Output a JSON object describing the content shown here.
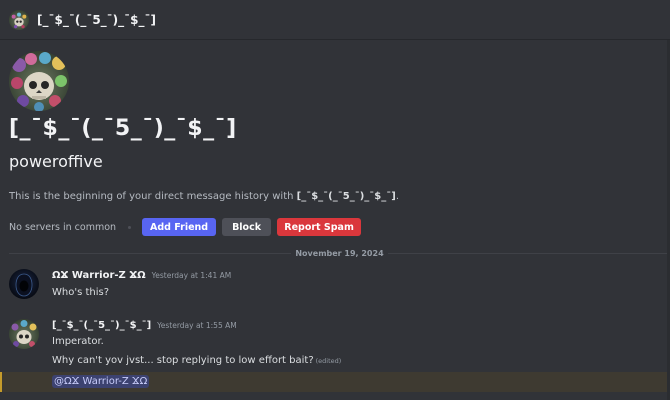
{
  "header": {
    "title": "[_ˉ$_ˉ(_ˉ5_ˉ)_ˉ$_ˉ]",
    "avatar_icon": "decorated-skull-avatar"
  },
  "profile": {
    "display_name": "[_ˉ$_ˉ(_ˉ5_ˉ)_ˉ$_ˉ]",
    "username": "poweroffive",
    "intro_prefix": "This is the beginning of your direct message history with ",
    "intro_name": "[_ˉ$_ˉ(_ˉ5_ˉ)_ˉ$_ˉ]",
    "intro_suffix": "."
  },
  "actions": {
    "mutual_servers": "No servers in common",
    "add_friend": "Add Friend",
    "block": "Block",
    "report_spam": "Report Spam"
  },
  "divider": {
    "date": "November 19, 2024"
  },
  "messages": [
    {
      "author": "ΩϪ Warrior-Z ϪΩ",
      "timestamp": "Yesterday at 1:41 AM",
      "lines": [
        "Who's this?"
      ]
    },
    {
      "author": "[_ˉ$_ˉ(_ˉ5_ˉ)_ˉ$_ˉ]",
      "timestamp": "Yesterday at 1:55 AM",
      "lines": [
        "Imperator.",
        "Why can't yov jvst... stop replying to low effort bait?"
      ],
      "edited_label": "(edited)",
      "mention": "@ΩϪ Warrior-Z ϪΩ"
    }
  ],
  "colors": {
    "background": "#313338",
    "blurple": "#5865f2",
    "danger": "#da373c",
    "secondary": "#4e5058",
    "mention_highlight": "#3e3a31",
    "mention_bar": "#c59b2b"
  }
}
